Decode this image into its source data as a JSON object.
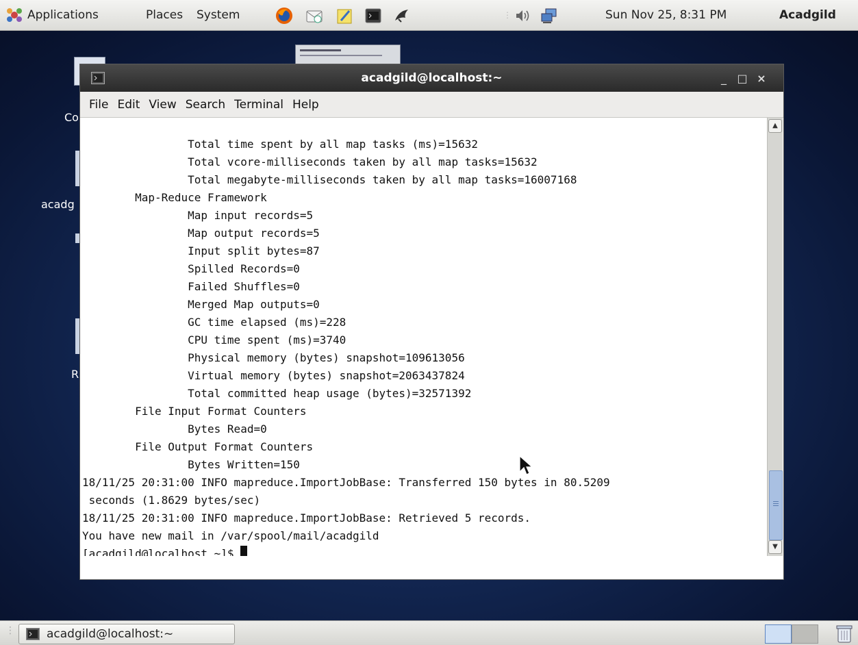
{
  "top_panel": {
    "menus": [
      "Applications",
      "Places",
      "System"
    ],
    "launchers": [
      "firefox-icon",
      "mail-icon",
      "notes-icon",
      "terminal-icon",
      "dolphin-icon"
    ],
    "clock": "Sun Nov 25,  8:31 PM",
    "user": "Acadgild"
  },
  "desktop": {
    "icon_labels": [
      "Co",
      "acadg",
      "R"
    ]
  },
  "terminal": {
    "title": "acadgild@localhost:~",
    "menu": [
      "File",
      "Edit",
      "View",
      "Search",
      "Terminal",
      "Help"
    ],
    "lines": [
      "                Total time spent by all map tasks (ms)=15632",
      "                Total vcore-milliseconds taken by all map tasks=15632",
      "                Total megabyte-milliseconds taken by all map tasks=16007168",
      "        Map-Reduce Framework",
      "                Map input records=5",
      "                Map output records=5",
      "                Input split bytes=87",
      "                Spilled Records=0",
      "                Failed Shuffles=0",
      "                Merged Map outputs=0",
      "                GC time elapsed (ms)=228",
      "                CPU time spent (ms)=3740",
      "                Physical memory (bytes) snapshot=109613056",
      "                Virtual memory (bytes) snapshot=2063437824",
      "                Total committed heap usage (bytes)=32571392",
      "        File Input Format Counters ",
      "                Bytes Read=0",
      "        File Output Format Counters ",
      "                Bytes Written=150",
      "18/11/25 20:31:00 INFO mapreduce.ImportJobBase: Transferred 150 bytes in 80.5209",
      " seconds (1.8629 bytes/sec)",
      "18/11/25 20:31:00 INFO mapreduce.ImportJobBase: Retrieved 5 records.",
      "You have new mail in /var/spool/mail/acadgild"
    ],
    "prompt": "[acadgild@localhost ~]$ "
  },
  "taskbar": {
    "window_label": "acadgild@localhost:~"
  },
  "colors": {
    "desktop_bg": "#142a58",
    "titlebar": "#2f2f2f",
    "scroll_thumb": "#a9c0e2"
  }
}
